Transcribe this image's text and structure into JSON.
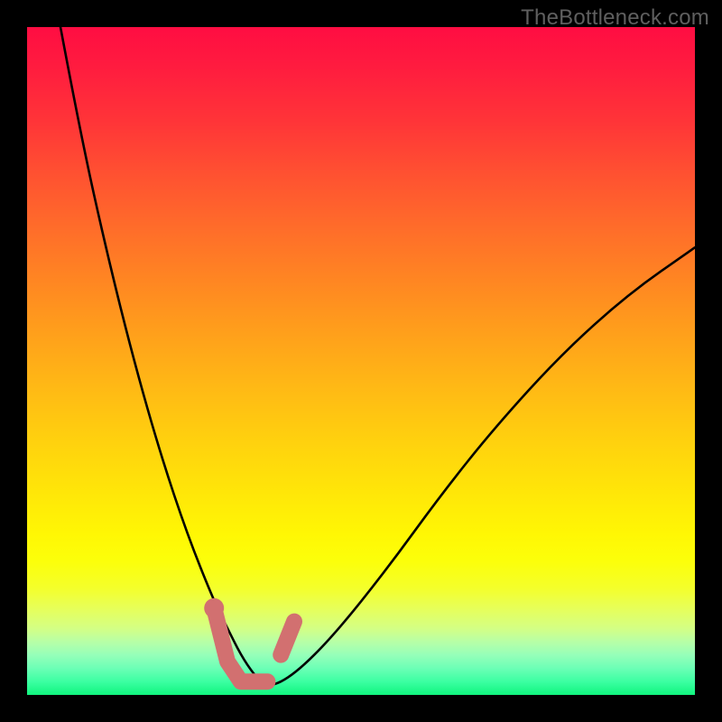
{
  "watermark": "TheBottleneck.com",
  "colors": {
    "background": "#000000",
    "curve_stroke": "#000000",
    "marker_stroke": "#d27070",
    "gradient_top": "#ff0d42",
    "gradient_mid": "#ffe708",
    "gradient_bottom": "#10f57e"
  },
  "chart_data": {
    "type": "line",
    "title": "",
    "xlabel": "",
    "ylabel": "",
    "xlim": [
      0,
      100
    ],
    "ylim": [
      0,
      100
    ],
    "grid": false,
    "legend": false,
    "series": [
      {
        "name": "bottleneck-curve",
        "x": [
          5,
          8,
          12,
          16,
          20,
          24,
          28,
          30,
          32,
          34,
          36,
          40,
          46,
          54,
          62,
          70,
          80,
          90,
          100
        ],
        "values": [
          100,
          84,
          66,
          50,
          36,
          24,
          14,
          10,
          6,
          3,
          1,
          3,
          9,
          19,
          30,
          40,
          51,
          60,
          67
        ]
      }
    ],
    "markers": [
      {
        "name": "highlight-L",
        "shape": "L",
        "points": [
          {
            "x": 28,
            "y": 13
          },
          {
            "x": 30,
            "y": 5
          },
          {
            "x": 32,
            "y": 2
          },
          {
            "x": 36,
            "y": 2
          }
        ]
      },
      {
        "name": "highlight-dash",
        "shape": "segment",
        "points": [
          {
            "x": 38,
            "y": 6
          },
          {
            "x": 40,
            "y": 11
          }
        ]
      }
    ],
    "annotations": []
  }
}
